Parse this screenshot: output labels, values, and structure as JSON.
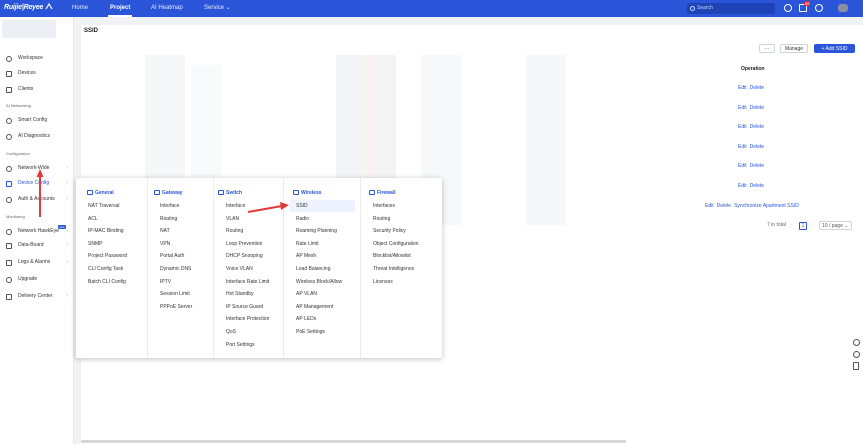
{
  "topbar": {
    "logo": "Ruijie|Reyee",
    "nav": [
      {
        "label": "Home"
      },
      {
        "label": "Project",
        "active": true
      },
      {
        "label": "AI Heatmap"
      },
      {
        "label": "Service",
        "dropdown": true
      }
    ],
    "search_placeholder": "Search",
    "notification_count": "99",
    "icons": [
      "target-icon",
      "bell-icon",
      "globe-icon",
      "avatar"
    ]
  },
  "sidebar": {
    "groups": [
      {
        "items": [
          {
            "label": "Workspace",
            "icon": "workspace-icon"
          },
          {
            "label": "Devices",
            "icon": "devices-icon"
          },
          {
            "label": "Clients",
            "icon": "clients-icon"
          }
        ]
      },
      {
        "title": "AI Networking",
        "items": [
          {
            "label": "Smart Config",
            "icon": "smart-config-icon"
          },
          {
            "label": "AI Diagnostics",
            "icon": "ai-diagnostics-icon"
          }
        ]
      },
      {
        "title": "Configuration",
        "items": [
          {
            "label": "Network-Wide",
            "icon": "network-wide-icon",
            "chevron": true
          },
          {
            "label": "Device Config",
            "icon": "device-config-icon",
            "chevron": true,
            "active": true
          },
          {
            "label": "Auth & Accounts",
            "icon": "auth-icon",
            "chevron": true
          }
        ]
      },
      {
        "title": "Monitoring",
        "items": [
          {
            "label": "Network HawkEye",
            "icon": "hawkeye-icon",
            "chevron": true,
            "badge": "new"
          },
          {
            "label": "Data-Board",
            "icon": "databoard-icon",
            "chevron": true
          },
          {
            "label": "Logs & Alarms",
            "icon": "logs-icon",
            "chevron": true
          },
          {
            "label": "Upgrade",
            "icon": "upgrade-icon"
          },
          {
            "label": "Delivery Center",
            "icon": "delivery-icon",
            "chevron": true
          }
        ]
      }
    ]
  },
  "main": {
    "title": "SSID",
    "buttons": {
      "more": "···",
      "manage": "Manage",
      "add": "+ Add SSID"
    },
    "operation_header": "Operation",
    "rows": [
      {
        "edit": "Edit",
        "delete": "Delete"
      },
      {
        "edit": "Edit",
        "delete": "Delete"
      },
      {
        "edit": "Edit",
        "delete": "Delete"
      },
      {
        "edit": "Edit",
        "delete": "Delete"
      },
      {
        "edit": "Edit",
        "delete": "Delete"
      },
      {
        "edit": "Edit",
        "delete": "Delete"
      },
      {
        "edit": "Edit",
        "delete": "Delete",
        "extra": "Synchronize Apartment SSID"
      }
    ],
    "pagination": {
      "total": "7 in total",
      "current": "1",
      "page_size": "10 / page"
    }
  },
  "mega_menu": {
    "columns": [
      {
        "title": "General",
        "icon": "general-icon",
        "items": [
          "NAT Traversal",
          "ACL",
          "IP-MAC Binding",
          "SNMP",
          "Project Password",
          "CLI Config Task",
          "Batch CLI Config"
        ]
      },
      {
        "title": "Gateway",
        "icon": "gateway-icon",
        "items": [
          "Interface",
          "Routing",
          "NAT",
          "VPN",
          "Portal Auth",
          "Dynamic DNS",
          "IPTV",
          "Session Limit",
          "PPPoE Server"
        ]
      },
      {
        "title": "Switch",
        "icon": "switch-icon",
        "items": [
          "Interface",
          "VLAN",
          "Routing",
          "Loop Prevention",
          "DHCP Snooping",
          "Voice VLAN",
          "Interface Rate Limit",
          "Hot Standby",
          "IP Source Guard",
          "Interface Protection",
          "QoS",
          "Port Settings"
        ]
      },
      {
        "title": "Wireless",
        "icon": "wireless-icon",
        "items": [
          "SSID",
          "Radio",
          "Roaming Planning",
          "Rate Limit",
          "AP Mesh",
          "Load Balancing",
          "Wireless Block/Allow",
          "AP VLAN",
          "AP Management",
          "AP LEDs",
          "PoE Settings"
        ],
        "highlight": 0
      },
      {
        "title": "Firewall",
        "icon": "firewall-icon",
        "items": [
          "Interfaces",
          "Routing",
          "Security Policy",
          "Object Configuration",
          "Blocklist/Allowlist",
          "Threat Intelligence",
          "Licenses"
        ]
      }
    ]
  },
  "colors": {
    "primary": "#2b55d8",
    "arrow": "#e23a3a"
  }
}
